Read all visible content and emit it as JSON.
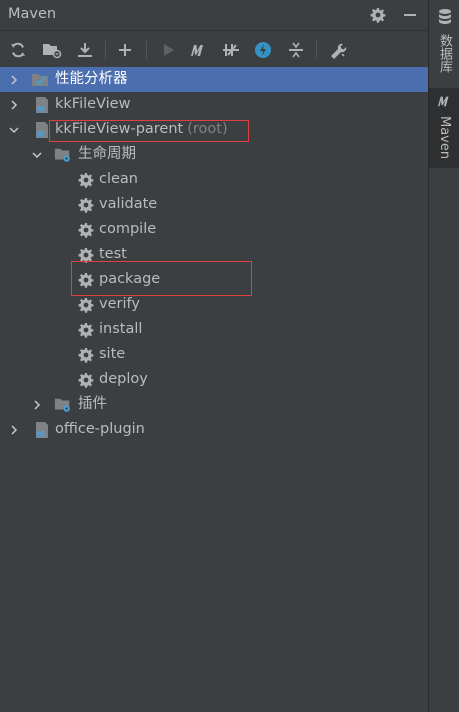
{
  "panel": {
    "title": "Maven"
  },
  "tree": {
    "items": [
      {
        "label": "性能分析器",
        "suffix": ""
      },
      {
        "label": "kkFileView",
        "suffix": ""
      },
      {
        "label": "kkFileView-parent",
        "suffix": "(root)"
      },
      {
        "label": "生命周期",
        "suffix": ""
      },
      {
        "label": "clean",
        "suffix": ""
      },
      {
        "label": "validate",
        "suffix": ""
      },
      {
        "label": "compile",
        "suffix": ""
      },
      {
        "label": "test",
        "suffix": ""
      },
      {
        "label": "package",
        "suffix": ""
      },
      {
        "label": "verify",
        "suffix": ""
      },
      {
        "label": "install",
        "suffix": ""
      },
      {
        "label": "site",
        "suffix": ""
      },
      {
        "label": "deploy",
        "suffix": ""
      },
      {
        "label": "插件",
        "suffix": ""
      },
      {
        "label": "office-plugin",
        "suffix": ""
      }
    ]
  },
  "sidebar": {
    "tabs": [
      {
        "label": "数据库"
      },
      {
        "label": "Maven"
      }
    ]
  },
  "colors": {
    "background": "#3c3f41",
    "selection": "#4b6eaf",
    "highlight_box": "#e04040",
    "module_icon": "#4a9ed6"
  }
}
